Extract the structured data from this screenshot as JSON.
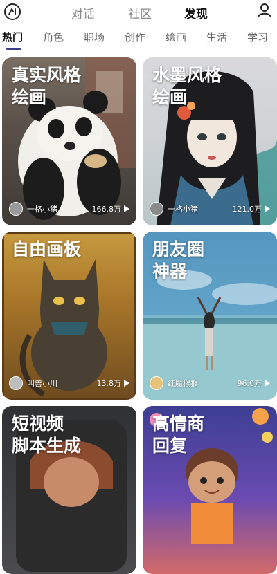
{
  "top_tabs": [
    "对话",
    "社区",
    "发现"
  ],
  "categories": [
    "热门",
    "角色",
    "职场",
    "创作",
    "绘画",
    "生活",
    "学习"
  ],
  "cards": [
    {
      "title": "真实风格\n绘画",
      "author": "一格小猪",
      "count": "166.8万"
    },
    {
      "title": "水墨风格\n绘画",
      "author": "一格小猪",
      "count": "121.0万"
    },
    {
      "title": "自由画板",
      "author": "叫兽小川",
      "count": "13.8万"
    },
    {
      "title": "朋友圈\n神器",
      "author": "红魔猴猴",
      "count": "96.0万"
    },
    {
      "title": "短视频\n脚本生成"
    },
    {
      "title": "高情商\n回复"
    }
  ]
}
